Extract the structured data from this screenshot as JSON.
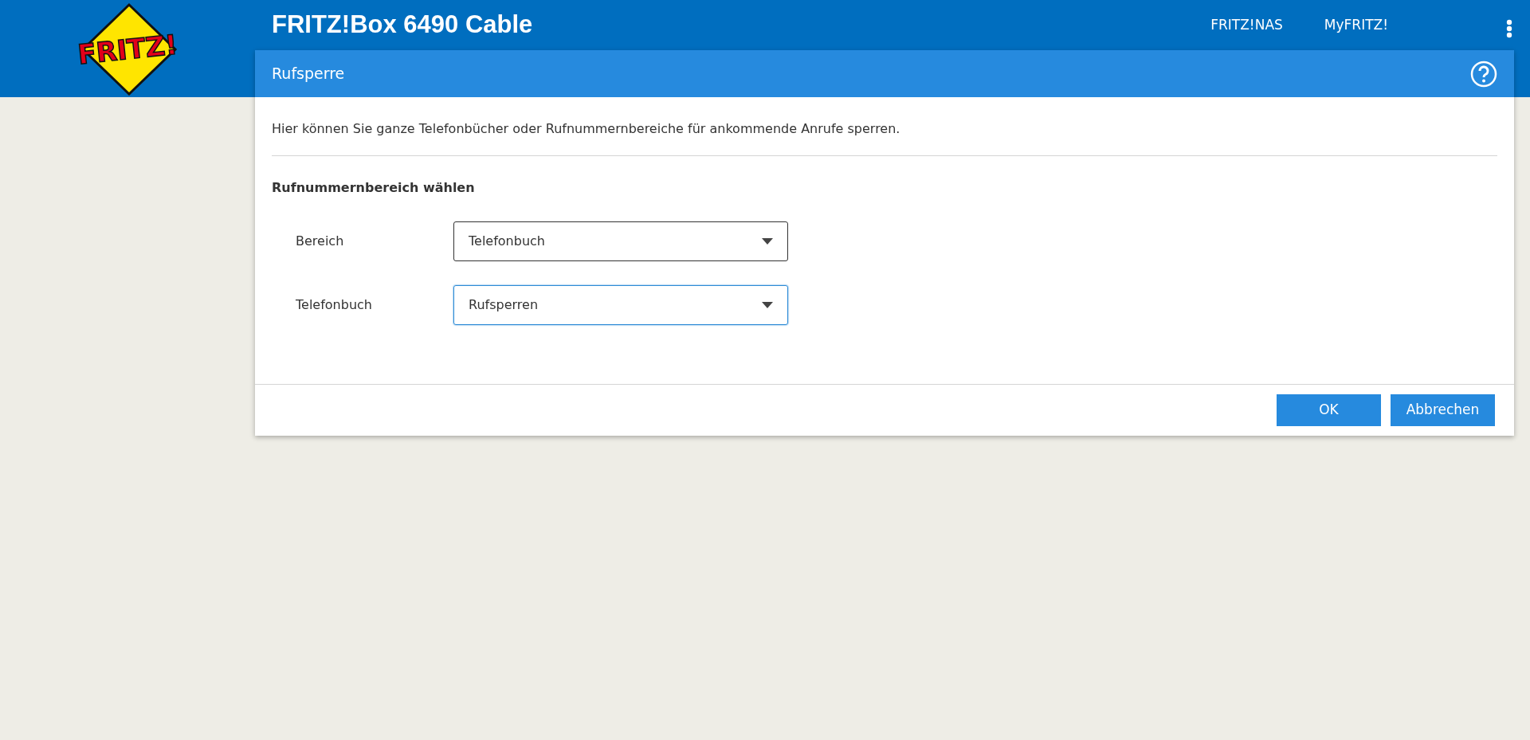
{
  "header": {
    "logo_text": "FRITZ!",
    "title": "FRITZ!Box 6490 Cable",
    "links": [
      "FRITZ!NAS",
      "MyFRITZ!"
    ]
  },
  "dialog": {
    "title": "Rufsperre",
    "intro": "Hier können Sie ganze Telefonbücher oder Rufnummernbereiche für ankommende Anrufe sperren.",
    "section_title": "Rufnummernbereich wählen",
    "fields": [
      {
        "label": "Bereich",
        "value": "Telefonbuch",
        "focused": false
      },
      {
        "label": "Telefonbuch",
        "value": "Rufsperren",
        "focused": true
      }
    ],
    "buttons": [
      "OK",
      "Abbrechen"
    ]
  }
}
